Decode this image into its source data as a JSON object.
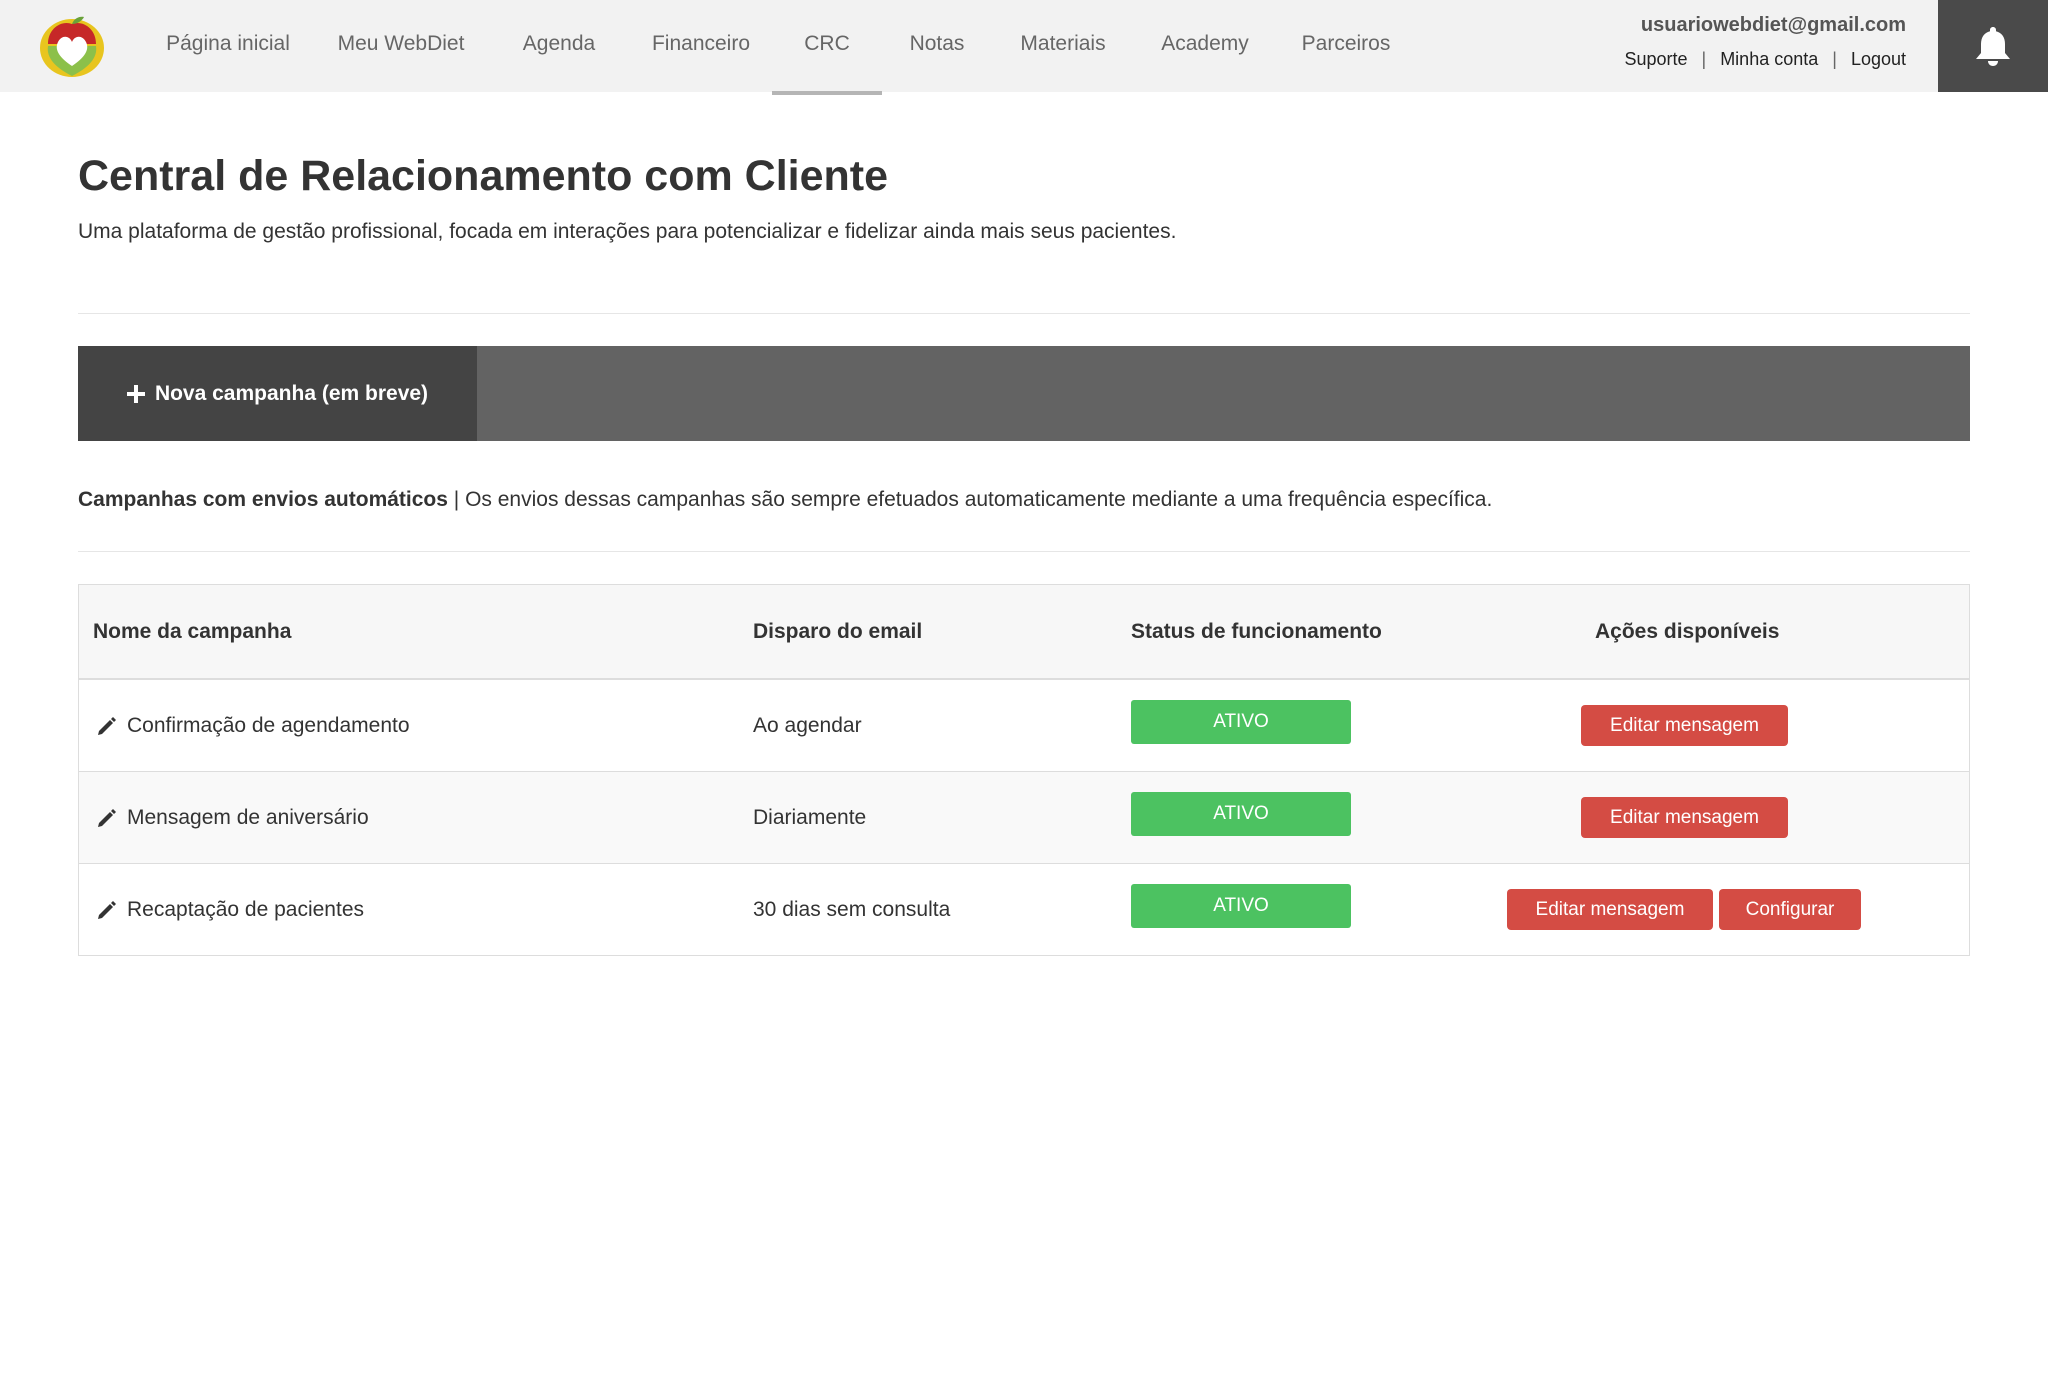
{
  "nav": {
    "items": [
      {
        "label": "Página inicial"
      },
      {
        "label": "Meu WebDiet"
      },
      {
        "label": "Agenda"
      },
      {
        "label": "Financeiro"
      },
      {
        "label": "CRC"
      },
      {
        "label": "Notas"
      },
      {
        "label": "Materiais"
      },
      {
        "label": "Academy"
      },
      {
        "label": "Parceiros"
      }
    ],
    "active": "CRC"
  },
  "user": {
    "email": "usuariowebdiet@gmail.com",
    "links": [
      "Suporte",
      "Minha conta",
      "Logout"
    ],
    "separator": "|"
  },
  "icons": {
    "logo": "webdiet-logo-icon",
    "bell": "bell-icon",
    "plus": "plus-icon",
    "pencil": "pencil-icon"
  },
  "page": {
    "title": "Central de Relacionamento com Cliente",
    "subtitle": "Uma plataforma de gestão profissional, focada em interações para potencializar e fidelizar ainda mais seus pacientes."
  },
  "campaign_bar": {
    "new_campaign_label": "Nova campanha (em breve)"
  },
  "auto_section": {
    "heading": "Campanhas com envios automáticos",
    "separator": " | ",
    "description": "Os envios dessas campanhas são sempre efetuados automaticamente mediante a uma frequência específica."
  },
  "table": {
    "headers": {
      "name": "Nome da campanha",
      "trigger": "Disparo do email",
      "status": "Status de funcionamento",
      "actions": "Ações disponíveis"
    },
    "rows": [
      {
        "name": "Confirmação de agendamento",
        "trigger": "Ao agendar",
        "status": "ATIVO",
        "actions": [
          "Editar mensagem"
        ]
      },
      {
        "name": "Mensagem de aniversário",
        "trigger": "Diariamente",
        "status": "ATIVO",
        "actions": [
          "Editar mensagem"
        ]
      },
      {
        "name": "Recaptação de pacientes",
        "trigger": "30 dias sem consulta",
        "status": "ATIVO",
        "actions": [
          "Editar mensagem",
          "Configurar"
        ]
      }
    ]
  },
  "colors": {
    "topbar_bg": "#f2f2f2",
    "bell_bg": "#4a4a4a",
    "campaign_bar_bg": "#636363",
    "new_campaign_bg": "#444444",
    "status_active": "#4cc261",
    "action_button": "#d44c44"
  }
}
